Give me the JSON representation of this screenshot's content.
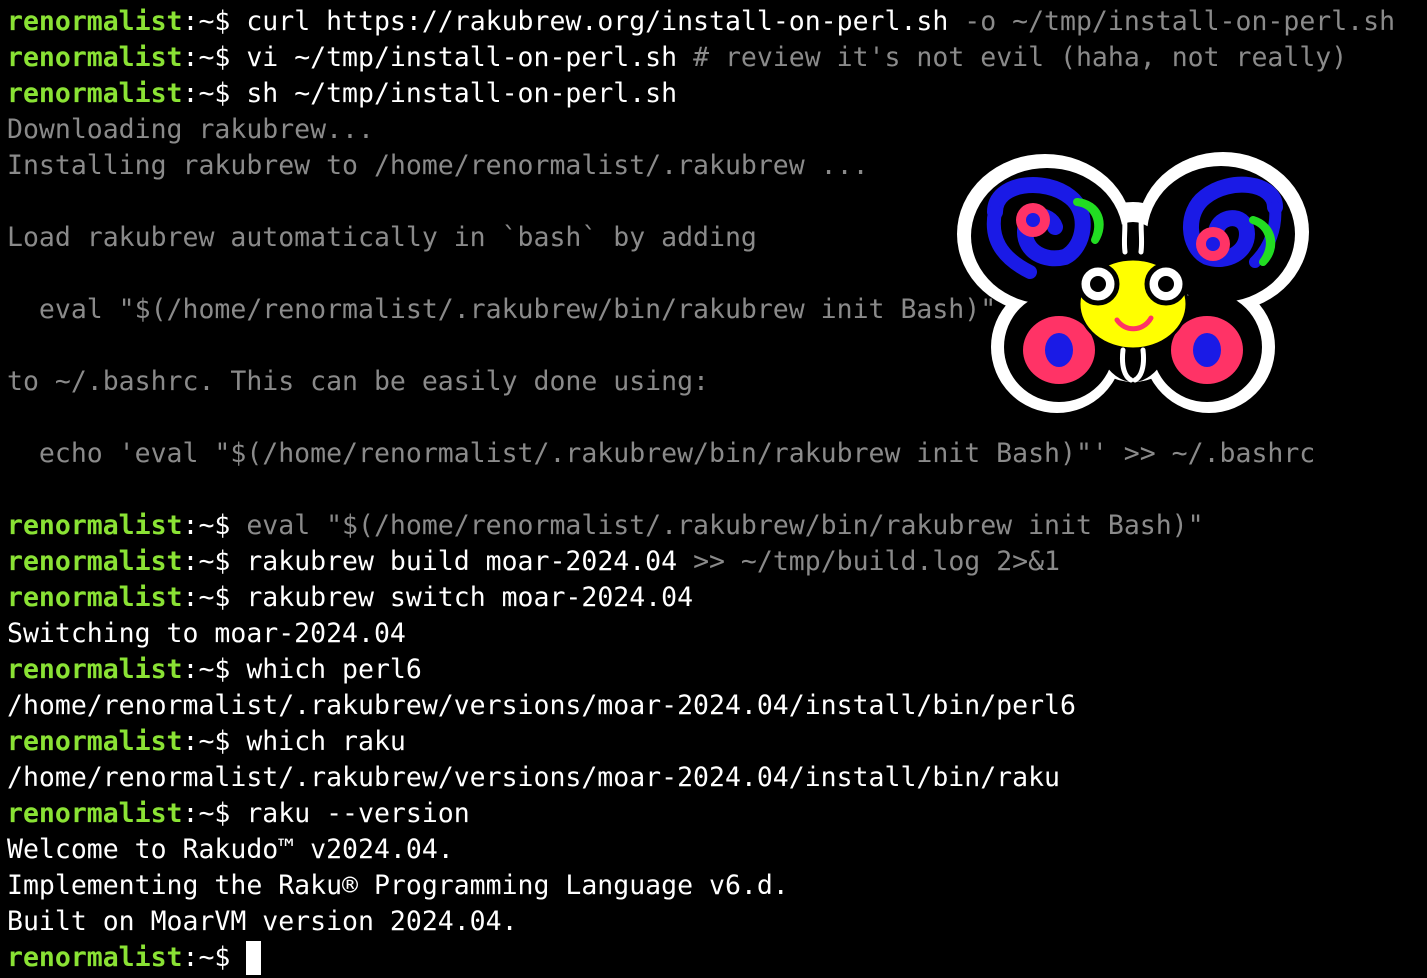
{
  "prompt": {
    "user": "renormalist",
    "sep": ":",
    "path": "~",
    "dollar": "$ "
  },
  "lines": [
    {
      "type": "cmd",
      "cmd": "curl https://rakubrew.org/install-on-perl.sh",
      "hint": " -o ~/tmp/install-on-perl.sh"
    },
    {
      "type": "cmd",
      "cmd": "vi ~/tmp/install-on-perl.sh",
      "hint": " # review it's not evil (haha, not really)"
    },
    {
      "type": "cmd",
      "cmd": "sh ~/tmp/install-on-perl.sh",
      "hint": ""
    },
    {
      "type": "dim",
      "text": "Downloading rakubrew..."
    },
    {
      "type": "dim",
      "text": "Installing rakubrew to /home/renormalist/.rakubrew ..."
    },
    {
      "type": "dim",
      "text": ""
    },
    {
      "type": "dim",
      "text": "Load rakubrew automatically in `bash` by adding"
    },
    {
      "type": "dim",
      "text": ""
    },
    {
      "type": "dim",
      "text": "  eval \"$(/home/renormalist/.rakubrew/bin/rakubrew init Bash)\""
    },
    {
      "type": "dim",
      "text": ""
    },
    {
      "type": "dim",
      "text": "to ~/.bashrc. This can be easily done using:"
    },
    {
      "type": "dim",
      "text": ""
    },
    {
      "type": "dim",
      "text": "  echo 'eval \"$(/home/renormalist/.rakubrew/bin/rakubrew init Bash)\"' >> ~/.bashrc"
    },
    {
      "type": "dim",
      "text": ""
    },
    {
      "type": "cmd",
      "cmd": "",
      "hint": "eval \"$(/home/renormalist/.rakubrew/bin/rakubrew init Bash)\""
    },
    {
      "type": "cmd",
      "cmd": "rakubrew build moar-2024.04",
      "hint": " >> ~/tmp/build.log 2>&1"
    },
    {
      "type": "cmd",
      "cmd": "rakubrew switch moar-2024.04",
      "hint": ""
    },
    {
      "type": "out",
      "text": "Switching to moar-2024.04"
    },
    {
      "type": "cmd",
      "cmd": "which perl6",
      "hint": ""
    },
    {
      "type": "out",
      "text": "/home/renormalist/.rakubrew/versions/moar-2024.04/install/bin/perl6"
    },
    {
      "type": "cmd",
      "cmd": "which raku",
      "hint": ""
    },
    {
      "type": "out",
      "text": "/home/renormalist/.rakubrew/versions/moar-2024.04/install/bin/raku"
    },
    {
      "type": "cmd",
      "cmd": "raku --version",
      "hint": ""
    },
    {
      "type": "out",
      "text": "Welcome to Rakudo™ v2024.04."
    },
    {
      "type": "out",
      "text": "Implementing the Raku® Programming Language v6.d."
    },
    {
      "type": "out",
      "text": "Built on MoarVM version 2024.04."
    },
    {
      "type": "cmd",
      "cmd": "",
      "hint": "",
      "cursor": true
    }
  ],
  "logo_icon": "camelia-butterfly-icon",
  "colors": {
    "prompt_user": "#8ae234",
    "text": "#ffffff",
    "dim": "#8a8a8a",
    "background": "#000000"
  }
}
